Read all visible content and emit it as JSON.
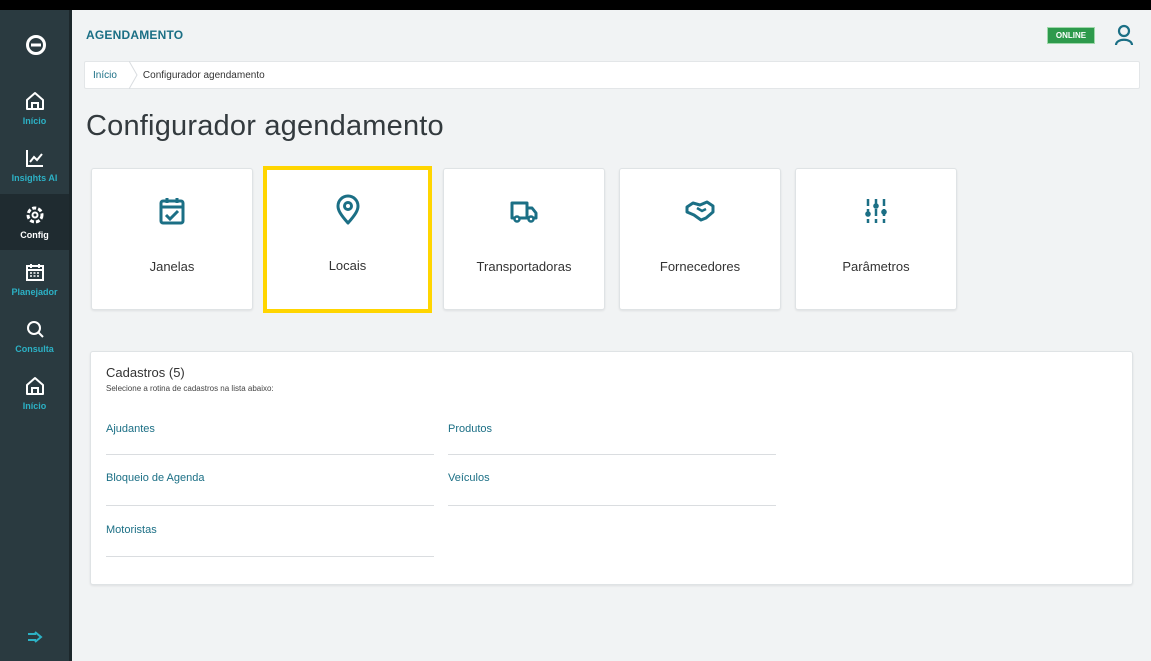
{
  "app": {
    "title": "AGENDAMENTO",
    "status": "ONLINE"
  },
  "sidebar": {
    "items": [
      {
        "label": "Início",
        "icon": "home-icon"
      },
      {
        "label": "Insights AI",
        "icon": "chart-icon"
      },
      {
        "label": "Config",
        "icon": "gear-icon"
      },
      {
        "label": "Planejador",
        "icon": "calendar-icon"
      },
      {
        "label": "Consulta",
        "icon": "search-icon"
      },
      {
        "label": "Início",
        "icon": "home-icon"
      }
    ]
  },
  "breadcrumb": {
    "home": "Início",
    "current": "Configurador agendamento"
  },
  "page": {
    "title": "Configurador agendamento"
  },
  "cards": [
    {
      "label": "Janelas",
      "icon": "calendar-check-icon"
    },
    {
      "label": "Locais",
      "icon": "location-pin-icon"
    },
    {
      "label": "Transportadoras",
      "icon": "truck-icon"
    },
    {
      "label": "Fornecedores",
      "icon": "handshake-icon"
    },
    {
      "label": "Parâmetros",
      "icon": "sliders-icon"
    }
  ],
  "cadastros": {
    "title": "Cadastros (5)",
    "subtitle": "Selecione a rotina de cadastros na lista abaixo:",
    "links": [
      "Ajudantes",
      "Bloqueio de Agenda",
      "Motoristas",
      "Produtos",
      "Veículos"
    ]
  },
  "colors": {
    "sidebar": "#2a3a40",
    "accent": "#1b6f85",
    "highlight": "#ffd500",
    "online": "#2e9a4c"
  }
}
